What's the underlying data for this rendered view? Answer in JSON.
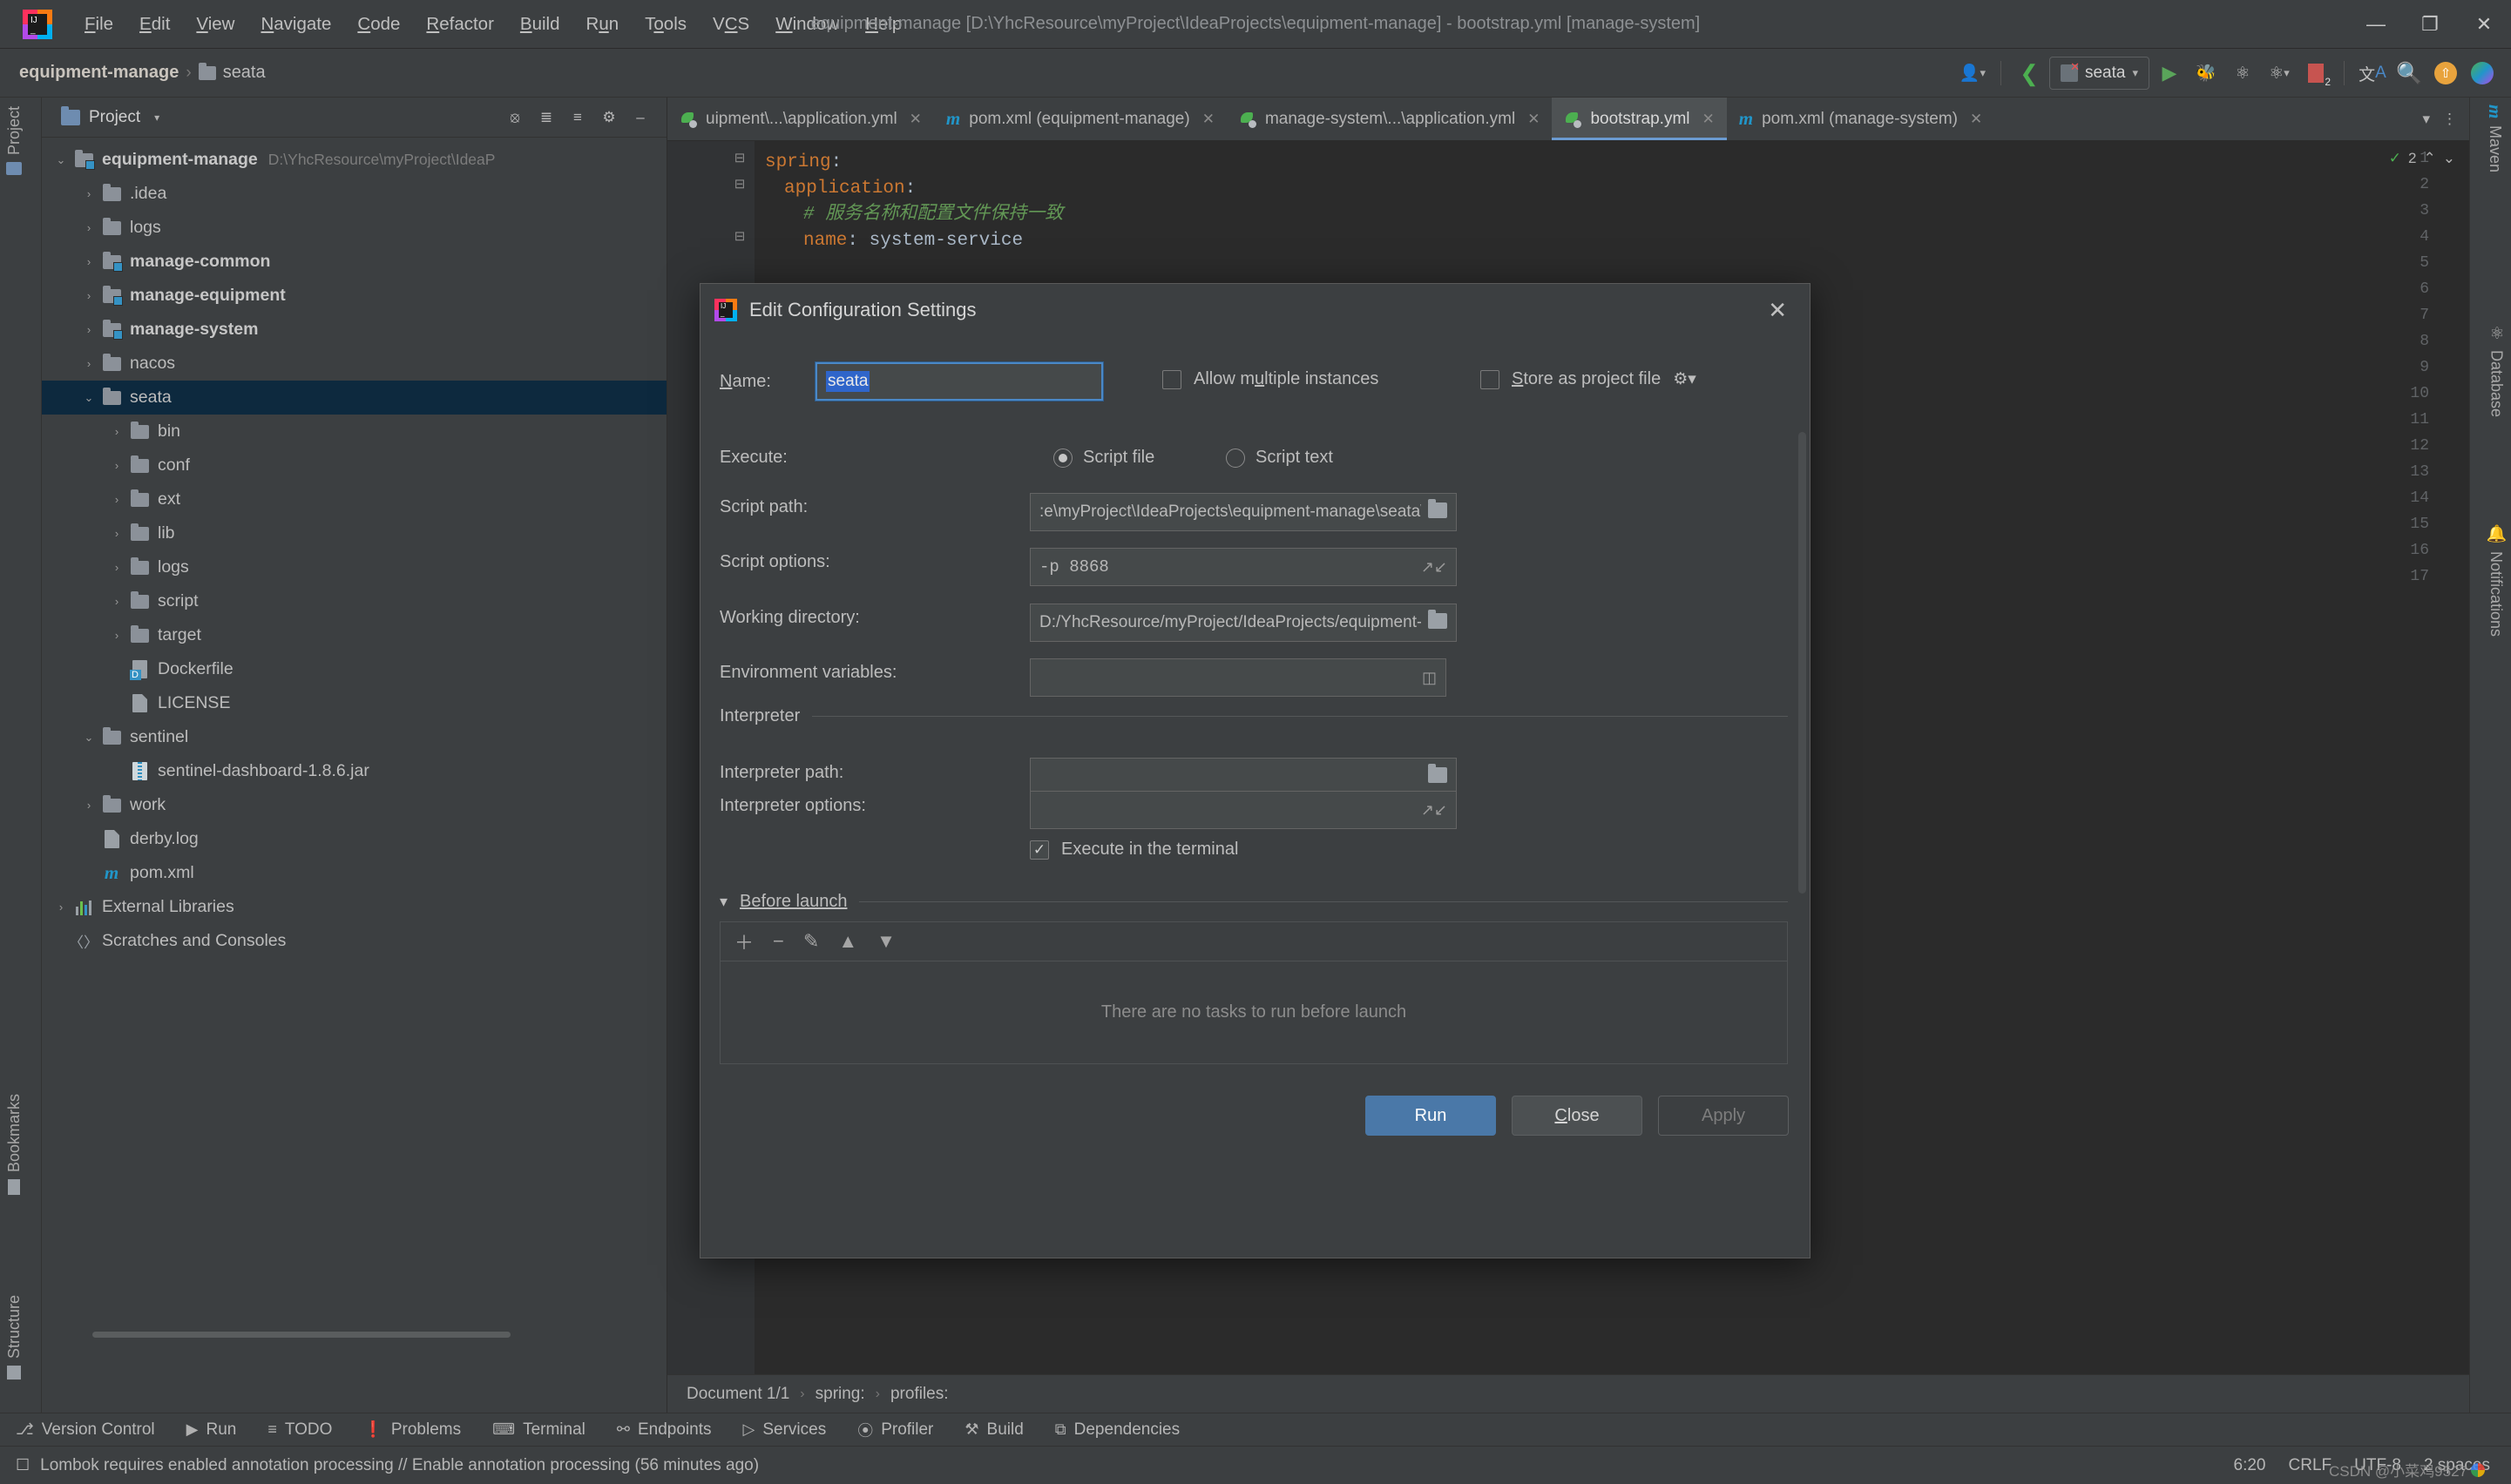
{
  "window": {
    "title": "equipment-manage [D:\\YhcResource\\myProject\\IdeaProjects\\equipment-manage] - bootstrap.yml [manage-system]",
    "minimize": "—",
    "maximize": "❐",
    "close": "✕"
  },
  "menubar": {
    "items": [
      "File",
      "Edit",
      "View",
      "Navigate",
      "Code",
      "Refactor",
      "Build",
      "Run",
      "Tools",
      "VCS",
      "Window",
      "Help"
    ]
  },
  "navbar": {
    "project": "equipment-manage",
    "separator": "›",
    "current": "seata",
    "run_config": "seata",
    "icons": {
      "profile": "user-icon",
      "build": "build-hammer-icon",
      "run": "run-icon",
      "debug": "debug-icon",
      "run_with_coverage": "coverage-icon",
      "profiler": "profiler-icon",
      "stop": "stop-icon",
      "translate": "translate-icon",
      "search": "search-icon",
      "updates": "updates-icon",
      "feedback": "feedback-icon"
    },
    "stop_badge": "2"
  },
  "left_rail": {
    "project_label": "Project",
    "bookmarks_label": "Bookmarks",
    "structure_label": "Structure"
  },
  "right_rail": {
    "maven_label": "Maven",
    "database_label": "Database",
    "notifications_label": "Notifications"
  },
  "project_panel": {
    "title": "Project",
    "caret": "▾",
    "tools": [
      "⊕",
      "☰",
      "≡",
      "⚙",
      "−"
    ],
    "tree": [
      {
        "indent": 0,
        "arrow": "⌄",
        "icon": "module-folder-icon",
        "label": "equipment-manage",
        "bold": true,
        "path": "D:\\YhcResource\\myProject\\IdeaP",
        "selected": false
      },
      {
        "indent": 1,
        "arrow": "›",
        "icon": "folder-icon",
        "label": ".idea",
        "bold": false,
        "path": "",
        "selected": false
      },
      {
        "indent": 1,
        "arrow": "›",
        "icon": "folder-icon",
        "label": "logs",
        "bold": false,
        "path": "",
        "selected": false
      },
      {
        "indent": 1,
        "arrow": "›",
        "icon": "module-folder-icon",
        "label": "manage-common",
        "bold": true,
        "path": "",
        "selected": false
      },
      {
        "indent": 1,
        "arrow": "›",
        "icon": "module-folder-icon",
        "label": "manage-equipment",
        "bold": true,
        "path": "",
        "selected": false
      },
      {
        "indent": 1,
        "arrow": "›",
        "icon": "module-folder-icon",
        "label": "manage-system",
        "bold": true,
        "path": "",
        "selected": false
      },
      {
        "indent": 1,
        "arrow": "›",
        "icon": "folder-icon",
        "label": "nacos",
        "bold": false,
        "path": "",
        "selected": false
      },
      {
        "indent": 1,
        "arrow": "⌄",
        "icon": "folder-icon",
        "label": "seata",
        "bold": false,
        "path": "",
        "selected": true
      },
      {
        "indent": 2,
        "arrow": "›",
        "icon": "folder-icon",
        "label": "bin",
        "bold": false,
        "path": "",
        "selected": false
      },
      {
        "indent": 2,
        "arrow": "›",
        "icon": "folder-icon",
        "label": "conf",
        "bold": false,
        "path": "",
        "selected": false
      },
      {
        "indent": 2,
        "arrow": "›",
        "icon": "folder-icon",
        "label": "ext",
        "bold": false,
        "path": "",
        "selected": false
      },
      {
        "indent": 2,
        "arrow": "›",
        "icon": "folder-icon",
        "label": "lib",
        "bold": false,
        "path": "",
        "selected": false
      },
      {
        "indent": 2,
        "arrow": "›",
        "icon": "folder-icon",
        "label": "logs",
        "bold": false,
        "path": "",
        "selected": false
      },
      {
        "indent": 2,
        "arrow": "›",
        "icon": "folder-icon",
        "label": "script",
        "bold": false,
        "path": "",
        "selected": false
      },
      {
        "indent": 2,
        "arrow": "›",
        "icon": "folder-icon",
        "label": "target",
        "bold": false,
        "path": "",
        "selected": false
      },
      {
        "indent": 2,
        "arrow": "",
        "icon": "dockerfile-icon",
        "label": "Dockerfile",
        "bold": false,
        "path": "",
        "selected": false
      },
      {
        "indent": 2,
        "arrow": "",
        "icon": "file-icon",
        "label": "LICENSE",
        "bold": false,
        "path": "",
        "selected": false
      },
      {
        "indent": 1,
        "arrow": "⌄",
        "icon": "folder-icon",
        "label": "sentinel",
        "bold": false,
        "path": "",
        "selected": false
      },
      {
        "indent": 2,
        "arrow": "",
        "icon": "jar-icon",
        "label": "sentinel-dashboard-1.8.6.jar",
        "bold": false,
        "path": "",
        "selected": false
      },
      {
        "indent": 1,
        "arrow": "›",
        "icon": "folder-icon",
        "label": "work",
        "bold": false,
        "path": "",
        "selected": false
      },
      {
        "indent": 1,
        "arrow": "",
        "icon": "file-icon",
        "label": "derby.log",
        "bold": false,
        "path": "",
        "selected": false
      },
      {
        "indent": 1,
        "arrow": "",
        "icon": "maven-icon",
        "label": "pom.xml",
        "bold": false,
        "path": "",
        "selected": false
      },
      {
        "indent": 0,
        "arrow": "›",
        "icon": "external-libraries-icon",
        "label": "External Libraries",
        "bold": false,
        "path": "",
        "selected": false
      },
      {
        "indent": 0,
        "arrow": "",
        "icon": "scratches-icon",
        "label": "Scratches and Consoles",
        "bold": false,
        "path": "",
        "selected": false
      }
    ]
  },
  "editor": {
    "tabs": [
      {
        "label": "uipment\\...\\application.yml",
        "icon": "yml-icon",
        "active": false,
        "close": "✕"
      },
      {
        "label": "pom.xml (equipment-manage)",
        "icon": "maven-icon",
        "active": false,
        "close": "✕"
      },
      {
        "label": "manage-system\\...\\application.yml",
        "icon": "yml-icon",
        "active": false,
        "close": "✕"
      },
      {
        "label": "bootstrap.yml",
        "icon": "yml-icon",
        "active": true,
        "close": "✕"
      },
      {
        "label": "pom.xml (manage-system)",
        "icon": "maven-icon",
        "active": false,
        "close": "✕"
      }
    ],
    "tabs_overflow": "▾",
    "tabs_menu": "⋮",
    "inspection_count": "2",
    "inspection_ok": "✓",
    "inspection_up": "⌃",
    "inspection_down": "⌄",
    "lines": [
      {
        "n": "1",
        "fold": "⊟",
        "indent": 0,
        "tokens": [
          {
            "t": "spring",
            "c": "key"
          },
          {
            "t": ":",
            "c": "val"
          }
        ]
      },
      {
        "n": "2",
        "fold": "⊟",
        "indent": 1,
        "tokens": [
          {
            "t": "application",
            "c": "key"
          },
          {
            "t": ":",
            "c": "val"
          }
        ]
      },
      {
        "n": "3",
        "fold": "",
        "indent": 2,
        "tokens": [
          {
            "t": "# 服务名称和配置文件保持一致",
            "c": "cmt"
          }
        ]
      },
      {
        "n": "4",
        "fold": "⊟",
        "indent": 2,
        "tokens": [
          {
            "t": "name",
            "c": "key"
          },
          {
            "t": ": system-service",
            "c": "val"
          }
        ]
      },
      {
        "n": "5",
        "fold": "",
        "indent": 0,
        "tokens": []
      },
      {
        "n": "6",
        "fold": "⊟",
        "indent": 0,
        "tokens": []
      },
      {
        "n": "7",
        "fold": "",
        "indent": 0,
        "tokens": []
      },
      {
        "n": "8",
        "fold": "",
        "indent": 0,
        "tokens": []
      },
      {
        "n": "9",
        "fold": "",
        "indent": 0,
        "tokens": []
      },
      {
        "n": "10",
        "fold": "",
        "indent": 0,
        "tokens": []
      },
      {
        "n": "11",
        "fold": "",
        "indent": 0,
        "tokens": []
      },
      {
        "n": "12",
        "fold": "",
        "indent": 0,
        "tokens": []
      },
      {
        "n": "13",
        "fold": "",
        "indent": 0,
        "tokens": []
      },
      {
        "n": "14",
        "fold": "",
        "indent": 0,
        "tokens": []
      },
      {
        "n": "15",
        "fold": "",
        "indent": 0,
        "tokens": []
      },
      {
        "n": "16",
        "fold": "",
        "indent": 0,
        "tokens": []
      },
      {
        "n": "17",
        "fold": "",
        "indent": 0,
        "tokens": []
      }
    ],
    "breadcrumb": [
      "Document 1/1",
      "spring:",
      "profiles:"
    ],
    "breadcrumb_sep": "›"
  },
  "dialog": {
    "title": "Edit Configuration Settings",
    "close": "✕",
    "name_label": "Name:",
    "name_value": "seata",
    "allow_multiple_instances": "Allow multiple instances",
    "allow_multiple_checked": false,
    "store_as_project_file": "Store as project file",
    "store_as_project_checked": false,
    "gear_icon": "gear-icon",
    "execute_label": "Execute:",
    "execute_options": [
      {
        "label": "Script file",
        "selected": true
      },
      {
        "label": "Script text",
        "selected": false
      }
    ],
    "script_path_label": "Script path:",
    "script_path_value": ":e\\myProject\\IdeaProjects\\equipment-manage\\seata\\bin\\seata-server.sh",
    "script_options_label": "Script options:",
    "script_options_value": "-p  8868",
    "working_directory_label": "Working directory:",
    "working_directory_value": "D:/YhcResource/myProject/IdeaProjects/equipment-manage",
    "environment_variables_label": "Environment variables:",
    "environment_variables_value": "",
    "interpreter_section": "Interpreter",
    "interpreter_path_label": "Interpreter path:",
    "interpreter_path_value": "",
    "interpreter_options_label": "Interpreter options:",
    "interpreter_options_value": "",
    "execute_in_terminal": "Execute in the terminal",
    "execute_in_terminal_checked": true,
    "before_launch_section": "Before launch",
    "before_launch_collapse": "▾",
    "before_launch_toolbar": [
      "＋",
      "−",
      "✎",
      "▲",
      "▼"
    ],
    "before_launch_empty": "There are no tasks to run before launch",
    "buttons": {
      "run": "Run",
      "close": "Close",
      "apply": "Apply"
    }
  },
  "bottom_toolwindows": [
    {
      "label": "Version Control",
      "icon": "branch-icon"
    },
    {
      "label": "Run",
      "icon": "run-icon"
    },
    {
      "label": "TODO",
      "icon": "todo-icon"
    },
    {
      "label": "Problems",
      "icon": "problems-icon"
    },
    {
      "label": "Terminal",
      "icon": "terminal-icon"
    },
    {
      "label": "Endpoints",
      "icon": "endpoints-icon"
    },
    {
      "label": "Services",
      "icon": "services-icon"
    },
    {
      "label": "Profiler",
      "icon": "profiler-icon"
    },
    {
      "label": "Build",
      "icon": "build-icon"
    },
    {
      "label": "Dependencies",
      "icon": "dependencies-icon"
    }
  ],
  "statusbar": {
    "message": "Lombok requires enabled annotation processing // Enable annotation processing (56 minutes ago)",
    "message_icon": "event-log-icon",
    "caret_position": "6:20",
    "line_separator": "CRLF",
    "encoding": "UTF-8",
    "indent": "2 spaces",
    "watermark": "CSDN @小菜鸡9527"
  }
}
